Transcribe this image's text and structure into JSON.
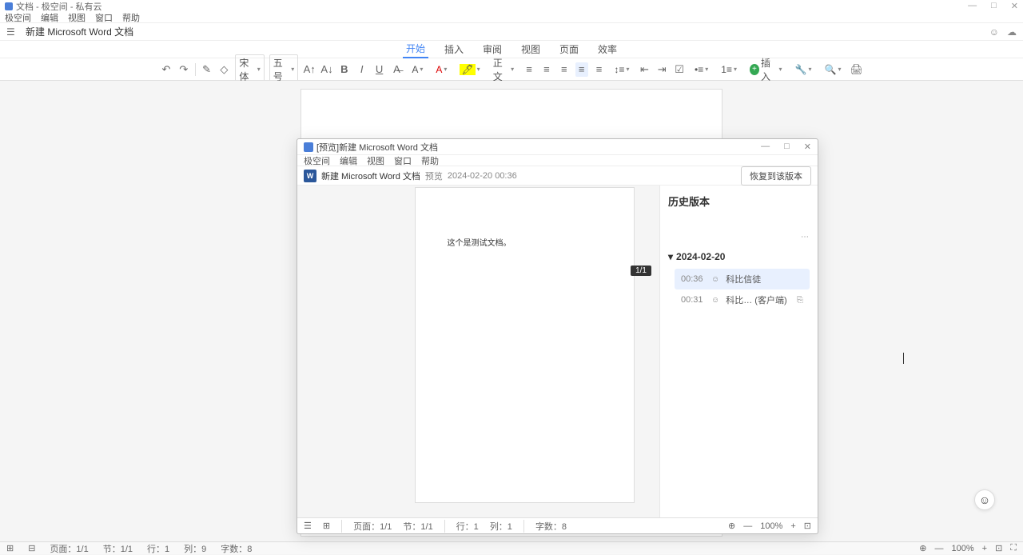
{
  "main_window": {
    "title": "文档 - 极空间 - 私有云",
    "menubar": [
      "极空间",
      "编辑",
      "视图",
      "窗口",
      "帮助"
    ],
    "tab_label": "新建 Microsoft Word 文档"
  },
  "ribbon": {
    "tabs": [
      "开始",
      "插入",
      "审阅",
      "视图",
      "页面",
      "效率"
    ],
    "active_tab": "开始"
  },
  "toolbar": {
    "font_name": "宋体",
    "font_size": "五号",
    "style_label": "正文",
    "insert_label": "插入"
  },
  "document": {
    "content": "这个是测试文档。"
  },
  "preview_window": {
    "title": "[预览]新建 Microsoft Word 文档",
    "menubar": [
      "极空间",
      "编辑",
      "视图",
      "窗口",
      "帮助"
    ],
    "doc_name": "新建 Microsoft Word 文档",
    "preview_label": "预览",
    "timestamp": "2024-02-20 00:36",
    "restore_btn": "恢复到该版本",
    "page_content": "这个是测试文档。",
    "page_indicator": "1/1",
    "history": {
      "title": "历史版本",
      "date": "2024-02-20",
      "items": [
        {
          "time": "00:36",
          "user": "科比信徒",
          "selected": true
        },
        {
          "time": "00:31",
          "user": "科比… (客户端)",
          "selected": false
        }
      ]
    },
    "statusbar": {
      "page": "页面：1/1",
      "section": "节：1/1",
      "line": "行：1",
      "col": "列：1",
      "words": "字数：8",
      "zoom": "100%"
    }
  },
  "main_statusbar": {
    "page": "页面：1/1",
    "section": "节：1/1",
    "line": "行：1",
    "col": "列：9",
    "words": "字数：8",
    "zoom": "100%"
  }
}
